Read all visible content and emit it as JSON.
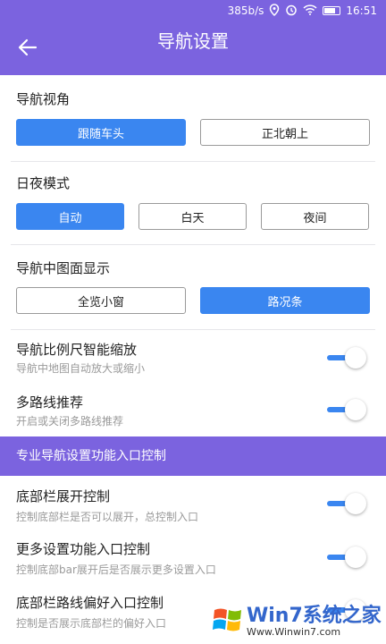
{
  "status_bar": {
    "speed": "385b/s",
    "time": "16:51"
  },
  "app_bar": {
    "title": "导航设置"
  },
  "nav_view": {
    "label": "导航视角",
    "options": [
      {
        "label": "跟随车头",
        "selected": true
      },
      {
        "label": "正北朝上",
        "selected": false
      }
    ]
  },
  "day_night": {
    "label": "日夜模式",
    "options": [
      {
        "label": "自动",
        "selected": true
      },
      {
        "label": "白天",
        "selected": false
      },
      {
        "label": "夜间",
        "selected": false
      }
    ]
  },
  "map_display": {
    "label": "导航中图面显示",
    "options": [
      {
        "label": "全览小窗",
        "selected": false
      },
      {
        "label": "路况条",
        "selected": true
      }
    ]
  },
  "toggles_top": [
    {
      "title": "导航比例尺智能缩放",
      "subtitle": "导航中地图自动放大或缩小",
      "on": true
    },
    {
      "title": "多路线推荐",
      "subtitle": "开启或关闭多路线推荐",
      "on": true
    }
  ],
  "pro_section": {
    "title": "专业导航设置功能入口控制"
  },
  "toggles_pro": [
    {
      "title": "底部栏展开控制",
      "subtitle": "控制底部栏是否可以展开，总控制入口",
      "on": true
    },
    {
      "title": "更多设置功能入口控制",
      "subtitle": "控制底部bar展开后是否展示更多设置入口",
      "on": true
    },
    {
      "title": "底部栏路线偏好入口控制",
      "subtitle": "控制是否展示底部栏的偏好入口",
      "on": true
    }
  ],
  "watermark": {
    "brand": "Win7系统之家",
    "url": "Www.Winwin7.com"
  },
  "colors": {
    "accent": "#7b63df",
    "primary": "#3a86f0"
  }
}
